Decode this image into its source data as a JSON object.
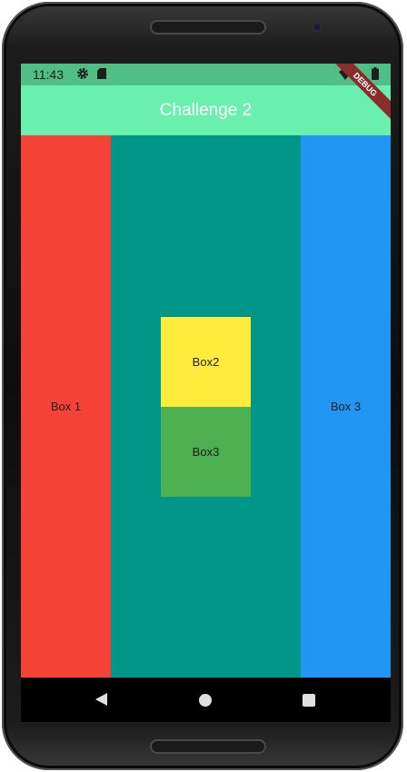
{
  "status_bar": {
    "time": "11:43",
    "icons": [
      "gear-icon",
      "sdcard-icon",
      "wifi-icon",
      "battery-icon"
    ]
  },
  "app_bar": {
    "title": "Challenge 2",
    "color": "#69f0ae"
  },
  "debug_banner": {
    "label": "DEBUG"
  },
  "columns": [
    {
      "label": "Box 1",
      "color": "#f44336"
    },
    {
      "color": "#009688"
    },
    {
      "label": "Box 3",
      "color": "#2196f3"
    }
  ],
  "center_boxes": [
    {
      "label": "Box2",
      "color": "#ffeb3b"
    },
    {
      "label": "Box3",
      "color": "#4caf50"
    }
  ],
  "nav_bar": {
    "icons": [
      "back-icon",
      "home-icon",
      "recents-icon"
    ]
  }
}
